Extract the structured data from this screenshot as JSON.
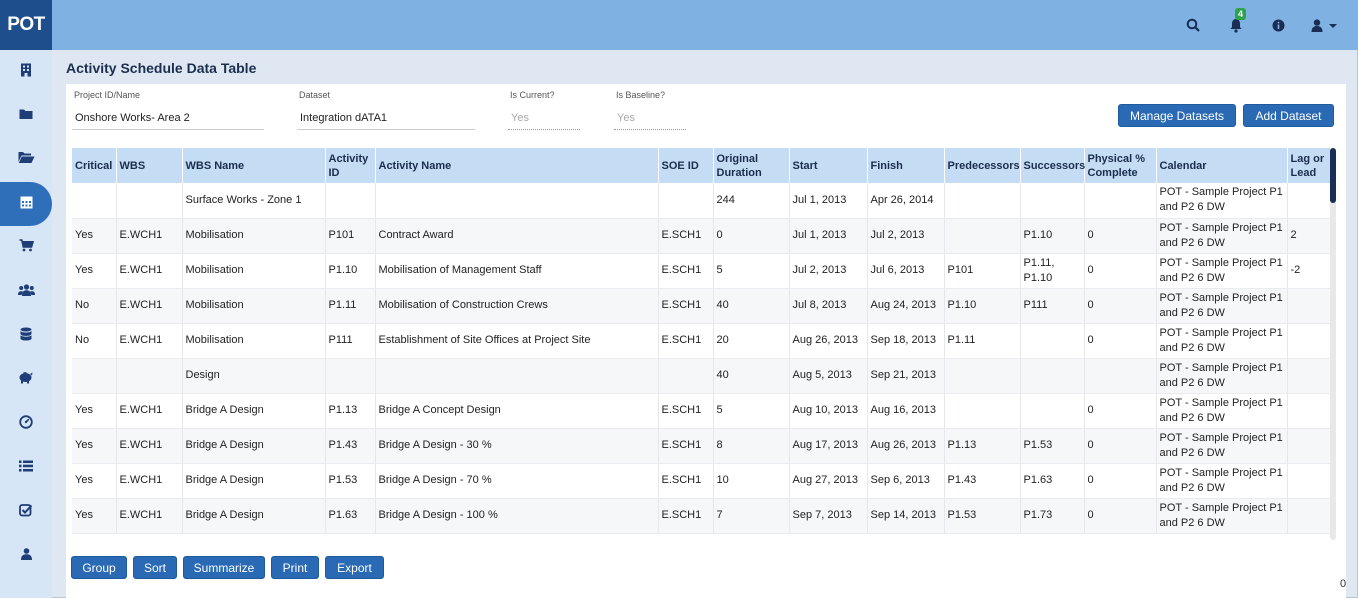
{
  "app": {
    "logo": "POT"
  },
  "topbar": {
    "notification_count": "4"
  },
  "page": {
    "title": "Activity Schedule Data Table"
  },
  "fields": {
    "project": {
      "label": "Project ID/Name",
      "value": "Onshore  Works- Area 2"
    },
    "dataset": {
      "label": "Dataset",
      "value": "Integration dATA1"
    },
    "is_current": {
      "label": "Is Current?",
      "value": "Yes"
    },
    "is_baseline": {
      "label": "Is Baseline?",
      "value": "Yes"
    }
  },
  "actions": {
    "manage_datasets": "Manage Datasets",
    "add_dataset": "Add Dataset"
  },
  "footer_buttons": {
    "group": "Group",
    "sort": "Sort",
    "summarize": "Summarize",
    "print": "Print",
    "export": "Export"
  },
  "corner_text": "0",
  "table": {
    "columns": [
      "Critical",
      "WBS",
      "WBS Name",
      "Activity ID",
      "Activity Name",
      "SOE ID",
      "Original Duration",
      "Start",
      "Finish",
      "Predecessors",
      "Successors",
      "Physical % Complete",
      "Calendar",
      "Lag or Lead"
    ],
    "rows": [
      [
        "",
        "",
        "Surface Works - Zone 1",
        "",
        "",
        "",
        "244",
        "Jul 1, 2013",
        "Apr 26, 2014",
        "",
        "",
        "",
        "POT - Sample Project P1 and P2 6 DW",
        ""
      ],
      [
        "Yes",
        "E.WCH1",
        "Mobilisation",
        "P101",
        "Contract Award",
        "E.SCH1",
        "0",
        "Jul 1, 2013",
        "Jul 2, 2013",
        "",
        "P1.10",
        "0",
        "POT - Sample Project P1 and P2 6 DW",
        "2"
      ],
      [
        "Yes",
        "E.WCH1",
        "Mobilisation",
        "P1.10",
        "Mobilisation of Management Staff",
        "E.SCH1",
        "5",
        "Jul 2, 2013",
        "Jul 6, 2013",
        "P101",
        "P1.11, P1.10",
        "0",
        "POT - Sample Project P1 and P2 6 DW",
        "-2"
      ],
      [
        "No",
        "E.WCH1",
        "Mobilisation",
        "P1.11",
        "Mobilisation of Construction Crews",
        "E.SCH1",
        "40",
        "Jul 8, 2013",
        "Aug 24, 2013",
        "P1.10",
        "P111",
        "0",
        "POT - Sample Project P1 and P2 6 DW",
        ""
      ],
      [
        "No",
        "E.WCH1",
        "Mobilisation",
        "P111",
        "Establishment of Site Offices at Project Site",
        "E.SCH1",
        "20",
        "Aug 26, 2013",
        "Sep 18, 2013",
        "P1.11",
        "",
        "0",
        "POT - Sample Project P1 and P2 6 DW",
        ""
      ],
      [
        "",
        "",
        "Design",
        "",
        "",
        "",
        "40",
        "Aug 5, 2013",
        "Sep 21, 2013",
        "",
        "",
        "",
        "POT - Sample Project P1 and P2 6 DW",
        ""
      ],
      [
        "Yes",
        "E.WCH1",
        "Bridge A Design",
        "P1.13",
        "Bridge A Concept Design",
        "E.SCH1",
        "5",
        "Aug 10, 2013",
        "Aug 16, 2013",
        "",
        "",
        "0",
        "POT - Sample Project P1 and P2 6 DW",
        ""
      ],
      [
        "Yes",
        "E.WCH1",
        "Bridge A Design",
        "P1.43",
        "Bridge A Design - 30 %",
        "E.SCH1",
        "8",
        "Aug 17, 2013",
        "Aug 26, 2013",
        "P1.13",
        "P1.53",
        "0",
        "POT - Sample Project P1 and P2 6 DW",
        ""
      ],
      [
        "Yes",
        "E.WCH1",
        "Bridge A Design",
        "P1.53",
        "Bridge A Design - 70 %",
        "E.SCH1",
        "10",
        "Aug 27, 2013",
        "Sep 6, 2013",
        "P1.43",
        "P1.63",
        "0",
        "POT - Sample Project P1 and P2 6 DW",
        ""
      ],
      [
        "Yes",
        "E.WCH1",
        "Bridge A Design",
        "P1.63",
        "Bridge A Design - 100 %",
        "E.SCH1",
        "7",
        "Sep 7, 2013",
        "Sep 14, 2013",
        "P1.53",
        "P1.73",
        "0",
        "POT - Sample Project P1 and P2 6 DW",
        ""
      ]
    ]
  }
}
